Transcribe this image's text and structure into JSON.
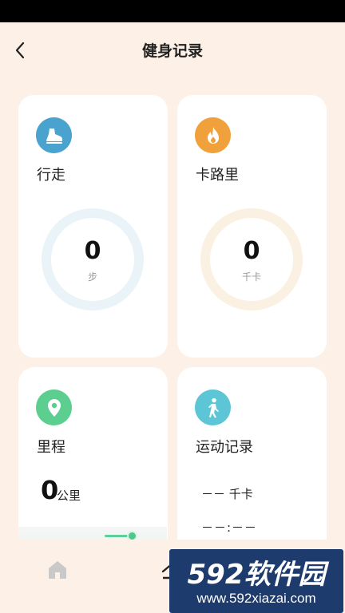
{
  "header": {
    "title": "健身记录",
    "back_icon": "chevron-left-icon"
  },
  "cards": {
    "walk": {
      "title": "行走",
      "value": "0",
      "unit": "步",
      "icon": "shoe-icon",
      "icon_color": "#4aa3cf",
      "ring_color": "#eaf4f8"
    },
    "calories": {
      "title": "卡路里",
      "value": "0",
      "unit": "千卡",
      "icon": "flame-icon",
      "icon_color": "#f0a13c",
      "ring_color": "#fbf1e2"
    },
    "distance": {
      "title": "里程",
      "value": "0",
      "unit": "公里",
      "icon": "location-pin-icon",
      "icon_color": "#5ccf90"
    },
    "records": {
      "title": "运动记录",
      "calories_value": "－－",
      "calories_unit": "千卡",
      "time_value": "－－:－－",
      "icon": "walking-person-icon",
      "icon_color": "#5cc6d6"
    }
  },
  "tabbar": {
    "home_icon": "home-icon"
  },
  "watermark": {
    "brand": "592软件园",
    "url": "www.592xiazai.com"
  }
}
